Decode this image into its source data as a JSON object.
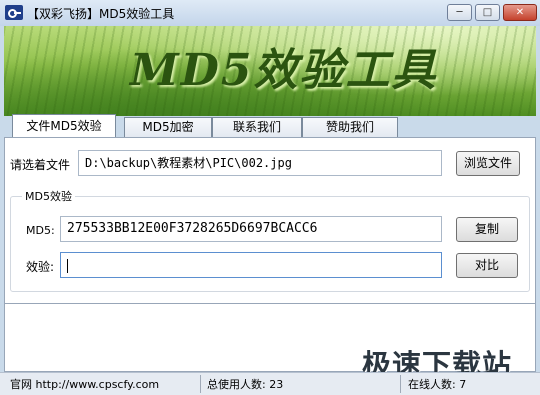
{
  "window": {
    "title": "【双彩飞扬】MD5效验工具",
    "icon": "key-icon",
    "controls": {
      "minimize": "─",
      "maximize": "□",
      "close": "✕"
    }
  },
  "banner": {
    "title": "MD5效验工具"
  },
  "tabs": [
    {
      "label": "文件MD5效验",
      "active": true
    },
    {
      "label": "MD5加密",
      "active": false
    },
    {
      "label": "联系我们",
      "active": false
    },
    {
      "label": "赞助我们",
      "active": false
    }
  ],
  "file_select": {
    "label": "请选着文件",
    "value": "D:\\backup\\教程素材\\PIC\\002.jpg",
    "browse_button": "浏览文件"
  },
  "md5_group": {
    "title": "MD5效验",
    "md5_label": "MD5:",
    "md5_value": "275533BB12E00F3728265D6697BCACC6",
    "copy_button": "复制",
    "verify_label": "效验:",
    "verify_value": "",
    "compare_button": "对比"
  },
  "watermark": "极速下载站",
  "statusbar": {
    "website": "官网 http://www.cpscfy.com",
    "total_users": "总使用人数: 23",
    "online_users": "在线人数: 7"
  }
}
